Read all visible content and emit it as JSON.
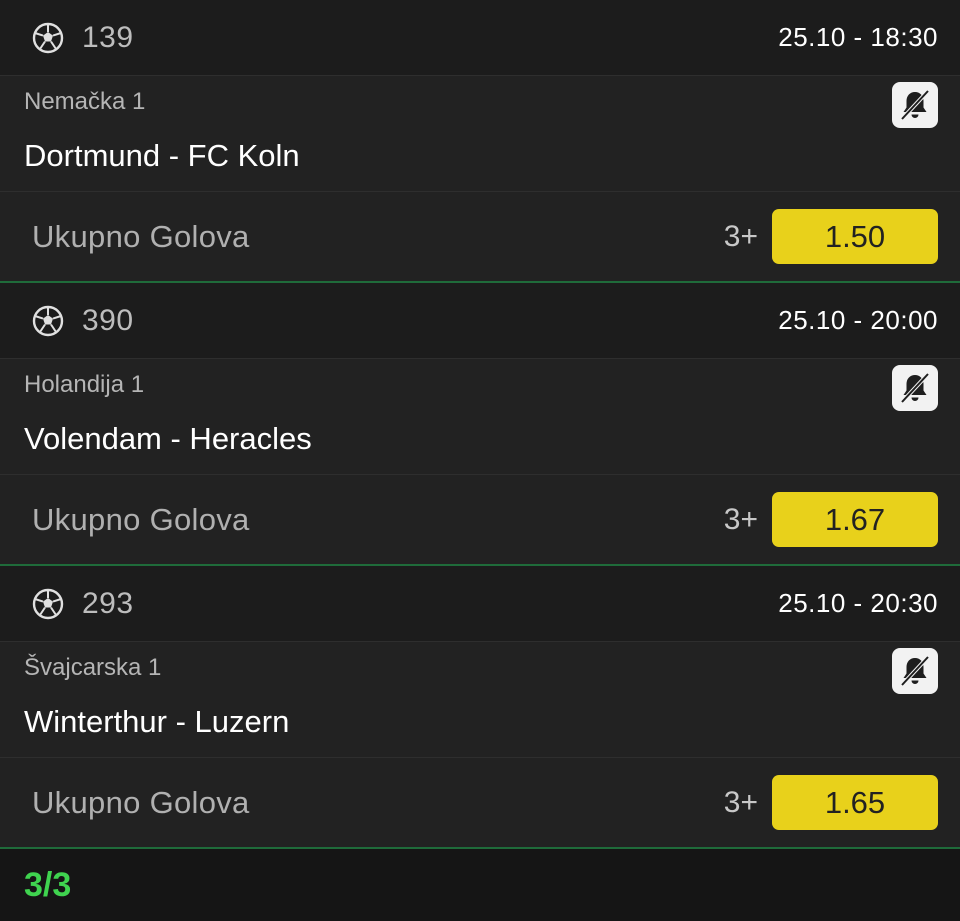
{
  "matches": [
    {
      "code": "139",
      "datetime": "25.10  -  18:30",
      "league": "Nemačka 1",
      "teams": "Dortmund - FC Koln",
      "market": "Ukupno Golova",
      "pick": "3+",
      "odd": "1.50",
      "sport_icon": "soccer-ball-icon",
      "alert_icon": "bell-off-icon"
    },
    {
      "code": "390",
      "datetime": "25.10  -  20:00",
      "league": "Holandija 1",
      "teams": "Volendam - Heracles",
      "market": "Ukupno Golova",
      "pick": "3+",
      "odd": "1.67",
      "sport_icon": "soccer-ball-icon",
      "alert_icon": "bell-off-icon"
    },
    {
      "code": "293",
      "datetime": "25.10  -  20:30",
      "league": "Švajcarska 1",
      "teams": "Winterthur - Luzern",
      "market": "Ukupno Golova",
      "pick": "3+",
      "odd": "1.65",
      "sport_icon": "soccer-ball-icon",
      "alert_icon": "bell-off-icon"
    }
  ],
  "footer": {
    "count": "3/3"
  },
  "colors": {
    "background": "#1e1e1e",
    "odd_button": "#e8d11b",
    "divider": "#1f6b3a",
    "count": "#3fd34f"
  }
}
